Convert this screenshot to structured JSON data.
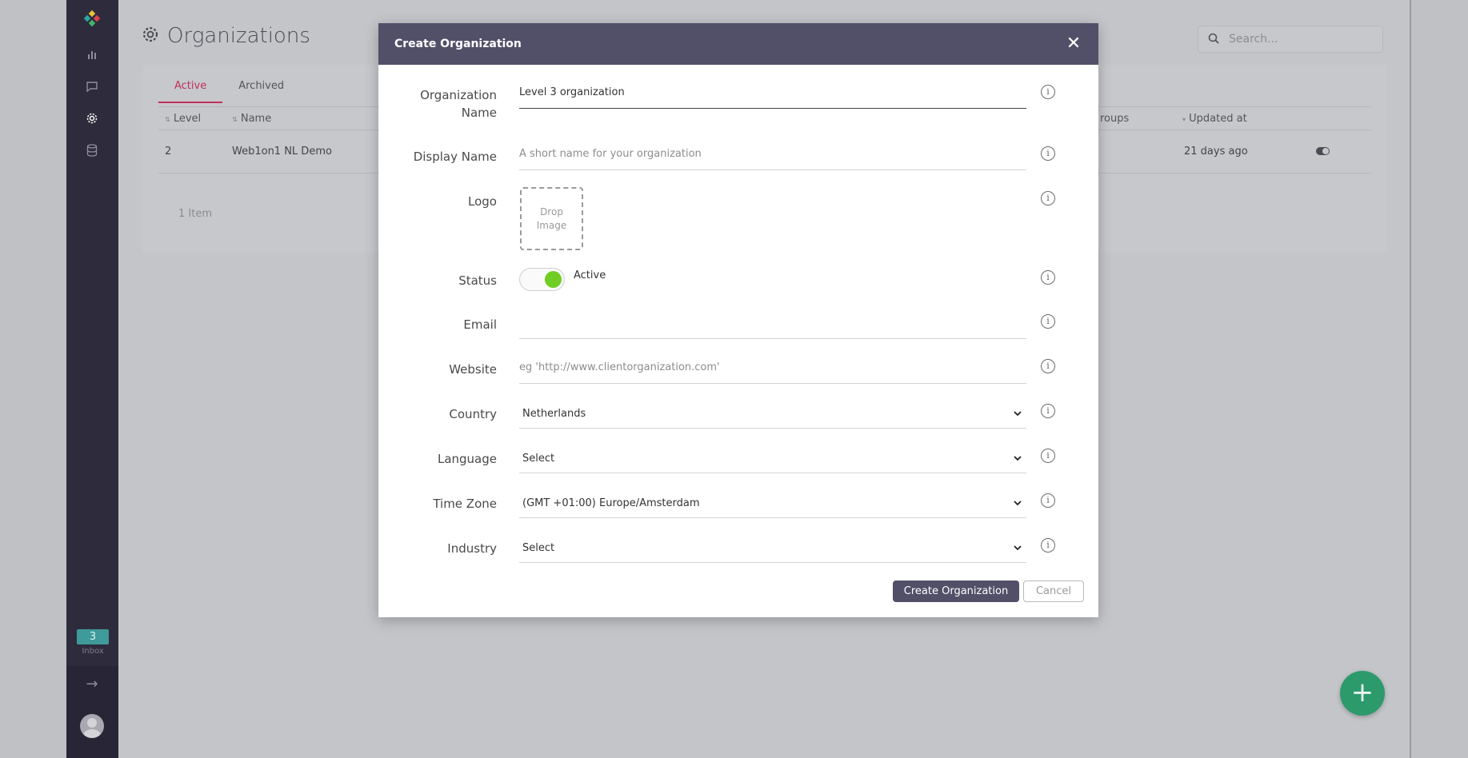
{
  "sidebar": {
    "logo_icon": "logo-icon",
    "nav_icons": [
      "bar-chart-icon",
      "chat-icon",
      "gear-icon",
      "database-icon"
    ],
    "inbox_count": "3",
    "inbox_label": "Inbox",
    "collapse_icon": "arrow-right-icon"
  },
  "page": {
    "title": "Organizations",
    "search_placeholder": "Search..."
  },
  "tabs": [
    "Active",
    "Archived"
  ],
  "table": {
    "headers": {
      "level": "Level",
      "name": "Name",
      "groups": "roups",
      "updated": "Updated at"
    },
    "row": {
      "level": "2",
      "name": "Web1on1 NL Demo",
      "updated": "21 days ago"
    },
    "count": "1 Item"
  },
  "modal": {
    "title": "Create Organization",
    "fields": {
      "org_name_label_1": "Organization",
      "org_name_label_2": "Name",
      "org_name_value": "Level 3 organization",
      "display_name_label": "Display Name",
      "display_name_placeholder": "A short name for your organization",
      "logo_label": "Logo",
      "drop_line1": "Drop",
      "drop_line2": "Image",
      "status_label": "Status",
      "status_value": "Active",
      "email_label": "Email",
      "website_label": "Website",
      "website_placeholder": "eg 'http://www.clientorganization.com'",
      "country_label": "Country",
      "country_value": "Netherlands",
      "language_label": "Language",
      "language_value": "Select",
      "timezone_label": "Time Zone",
      "timezone_value": "(GMT +01:00) Europe/Amsterdam",
      "industry_label": "Industry",
      "industry_value": "Select"
    },
    "create_button": "Create Organization",
    "cancel_button": "Cancel"
  },
  "colors": {
    "sidebar": "#2e2c3c",
    "modal_header": "#524f69",
    "accent_tab": "#c22f59",
    "switch_on": "#6fcd24",
    "fab": "#2d9a6c",
    "inbox_badge": "#3f9a9a"
  }
}
